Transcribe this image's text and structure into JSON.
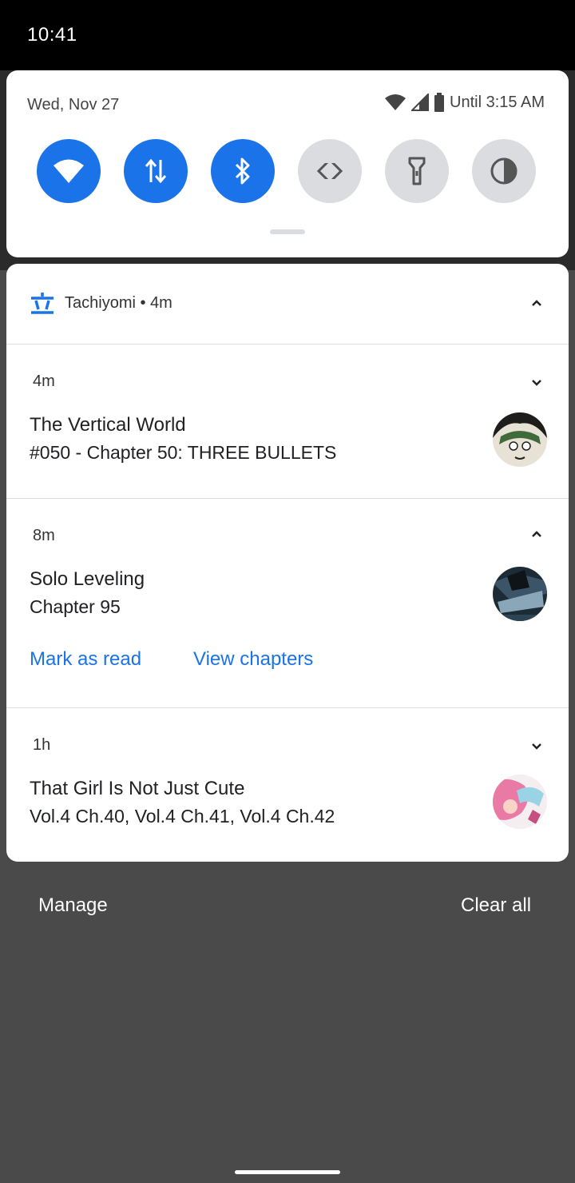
{
  "status_bar": {
    "time": "10:41"
  },
  "quick_settings": {
    "date": "Wed, Nov 27",
    "battery_text": "Until 3:15 AM",
    "tiles": [
      {
        "name": "wifi",
        "state": "on"
      },
      {
        "name": "mobile-data",
        "state": "on"
      },
      {
        "name": "bluetooth",
        "state": "on"
      },
      {
        "name": "auto-rotate",
        "state": "off"
      },
      {
        "name": "flashlight",
        "state": "off"
      },
      {
        "name": "invert-colors",
        "state": "off"
      }
    ]
  },
  "notification_group": {
    "app_label": "Tachiyomi • 4m",
    "notifications": [
      {
        "time": "4m",
        "title": "The Vertical World",
        "text": "#050 - Chapter 50: THREE BULLETS",
        "expanded": false
      },
      {
        "time": "8m",
        "title": "Solo Leveling",
        "text": "Chapter 95",
        "expanded": true,
        "actions": [
          "Mark as read",
          "View chapters"
        ]
      },
      {
        "time": "1h",
        "title": "That Girl Is Not Just Cute",
        "text": "Vol.4 Ch.40, Vol.4 Ch.41, Vol.4 Ch.42",
        "expanded": false
      }
    ]
  },
  "footer": {
    "manage": "Manage",
    "clear_all": "Clear all"
  },
  "colors": {
    "accent": "#1a73e8",
    "tile_off": "#dadce0",
    "shade": "#4a4a4a"
  }
}
